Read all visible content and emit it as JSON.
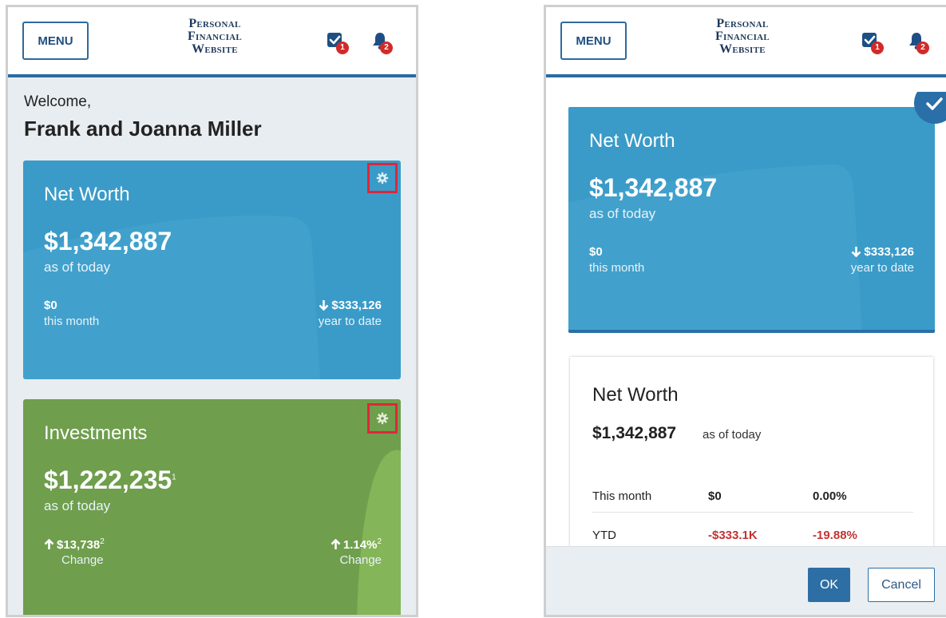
{
  "header": {
    "menu_label": "MENU",
    "brand_line1": "Personal",
    "brand_line2": "Financial",
    "brand_line3": "Website",
    "tasks_badge": "1",
    "notifications_badge": "2"
  },
  "left": {
    "welcome": "Welcome,",
    "user_name": "Frank and Joanna Miller",
    "net_worth": {
      "title": "Net Worth",
      "amount": "$1,342,887",
      "as_of": "as of today",
      "month_value": "$0",
      "month_label": "this month",
      "ytd_value": "$333,126",
      "ytd_label": "year to date"
    },
    "investments": {
      "title": "Investments",
      "amount": "$1,222,235",
      "amount_footnote": "1",
      "as_of": "as of today",
      "change_value": "$13,738",
      "change_footnote": "2",
      "change_label": "Change",
      "pct_value": "1.14%",
      "pct_footnote": "2",
      "pct_label": "Change"
    }
  },
  "right": {
    "card": {
      "title": "Net Worth",
      "amount": "$1,342,887",
      "as_of": "as of today",
      "month_value": "$0",
      "month_label": "this month",
      "ytd_value": "$333,126",
      "ytd_label": "year to date"
    },
    "panel": {
      "title": "Net Worth",
      "amount": "$1,342,887",
      "as_of": "as of today",
      "rows": [
        {
          "label": "This month",
          "value": "$0",
          "percent": "0.00%"
        },
        {
          "label": "YTD",
          "value": "-$333.1K",
          "percent": "-19.88%"
        }
      ]
    },
    "ok_label": "OK",
    "cancel_label": "Cancel"
  },
  "colors": {
    "header_rule": "#2a6aa3",
    "card_blue": "#3a9bc8",
    "card_green": "#6f9e4d",
    "highlight": "#e0263a",
    "negative": "#c43232",
    "primary_button": "#2d6ea4"
  },
  "icons": {
    "tasks": "checkbox-icon",
    "notifications": "bell-icon",
    "settings": "gear-icon",
    "arrow_down": "arrow-down-icon",
    "arrow_up": "arrow-up-icon",
    "selected": "checkmark-icon"
  }
}
